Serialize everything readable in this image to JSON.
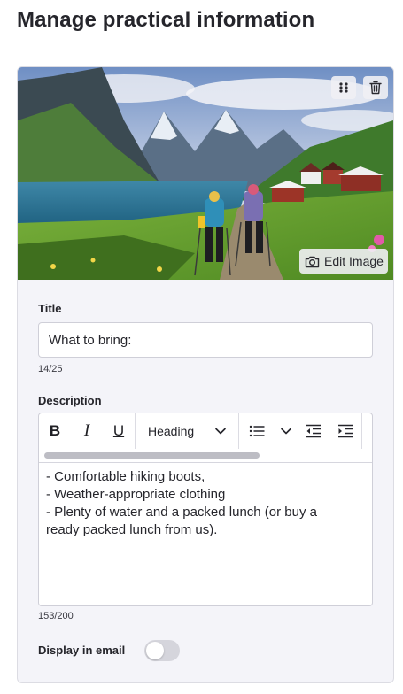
{
  "page": {
    "title": "Manage practical information"
  },
  "card": {
    "image": {
      "alt": "Hikers walking on a trail toward red cabins beside a mountain lake",
      "edit_label": "Edit Image",
      "icons": {
        "drag": "drag-handle-icon",
        "delete": "trash-icon",
        "edit": "camera-icon"
      }
    },
    "title_field": {
      "label": "Title",
      "value": "What to bring:",
      "counter": "14/25"
    },
    "description": {
      "label": "Description",
      "toolbar": {
        "bold": "B",
        "italic": "I",
        "underline": "U",
        "heading": "Heading",
        "icons": [
          "bold-icon",
          "italic-icon",
          "underline-icon",
          "chevron-down-icon",
          "bulleted-list-icon",
          "outdent-icon",
          "indent-icon"
        ]
      },
      "lines": [
        "- Comfortable hiking boots,",
        "- Weather-appropriate clothing",
        "- Plenty of water and a packed lunch (or buy a",
        "ready packed lunch from us)."
      ],
      "counter": "153/200"
    },
    "display_in_email": {
      "label": "Display in email",
      "enabled": false
    }
  },
  "colors": {
    "card_background": "#f4f4f9",
    "border": "#dcdce3",
    "toggle_off": "#d5d5dc",
    "text": "#25252b"
  }
}
